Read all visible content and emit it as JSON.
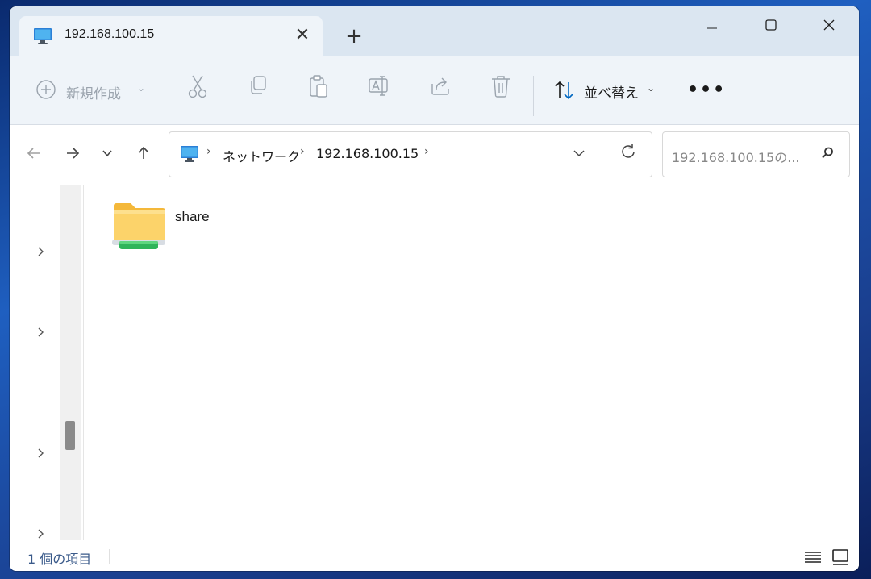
{
  "tab": {
    "title": "192.168.100.15",
    "close_glyph": "✕",
    "add_glyph": "+"
  },
  "window_controls": {
    "minimize": "—",
    "maximize": "☐",
    "close": "✕"
  },
  "commandbar": {
    "new_label": "新規作成",
    "sort_label": "並べ替え",
    "more_label": "•••",
    "icons": [
      "cut-icon",
      "copy-icon",
      "paste-icon",
      "rename-icon",
      "share-icon",
      "delete-icon"
    ]
  },
  "address": {
    "crumbs": [
      "ネットワーク",
      "192.168.100.15"
    ]
  },
  "search": {
    "placeholder": "192.168.100.15の..."
  },
  "items": [
    {
      "name": "share",
      "type": "network-share-folder"
    }
  ],
  "status": {
    "count_text": "1 個の項目"
  },
  "colors": {
    "accent": "#0067c0",
    "tab_bar": "#dbe6f1",
    "command_bar": "#eff4f9"
  }
}
